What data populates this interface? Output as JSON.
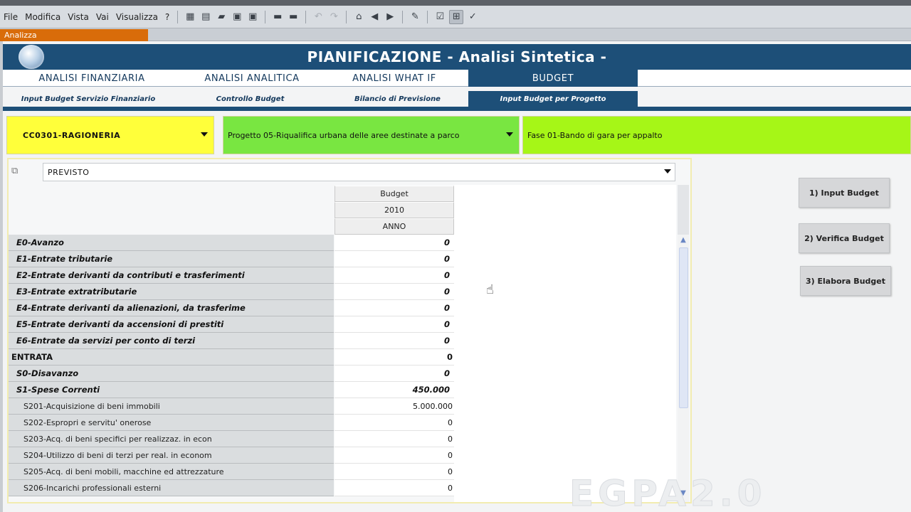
{
  "menubar": {
    "items": [
      "File",
      "Modifica",
      "Vista",
      "Vai",
      "Visualizza",
      "?"
    ]
  },
  "toolbar_icons": [
    "grid-icon",
    "page-icon",
    "folder-open-icon",
    "save-icon",
    "save-as-icon",
    "print-icon",
    "print-preview-icon",
    "undo-icon",
    "redo-icon",
    "home-icon",
    "back-icon",
    "forward-icon",
    "tools-icon",
    "checklist-icon",
    "filter-icon",
    "check-icon"
  ],
  "window_tab": {
    "label": "Analizza"
  },
  "header": {
    "title": "PIANIFICAZIONE  - Analisi Sintetica  -"
  },
  "main_tabs": [
    {
      "label": "ANALISI FINANZIARIA",
      "active": false
    },
    {
      "label": "ANALISI ANALITICA",
      "active": false
    },
    {
      "label": "ANALISI WHAT IF",
      "active": false
    },
    {
      "label": "BUDGET",
      "active": true
    }
  ],
  "sub_tabs": [
    {
      "label": "Input Budget Servizio Finanziario",
      "active": false
    },
    {
      "label": "Controllo Budget",
      "active": false
    },
    {
      "label": "Bilancio di Previsione",
      "active": false
    },
    {
      "label": "Input Budget per Progetto",
      "active": true
    }
  ],
  "selectors": {
    "cost_center": "CC0301-RAGIONERIA",
    "project": "Progetto 05-Riqualifica urbana delle aree destinate a parco",
    "phase": "Fase 01-Bando di gara per appalto"
  },
  "scenario_select": {
    "value": "PREVISTO"
  },
  "table": {
    "column_headers": [
      "Budget",
      "2010",
      "ANNO"
    ],
    "rows": [
      {
        "label": "E0-Avanzo",
        "value": "0"
      },
      {
        "label": "E1-Entrate tributarie",
        "value": "0"
      },
      {
        "label": "E2-Entrate derivanti da contributi e trasferimenti",
        "value": "0"
      },
      {
        "label": "E3-Entrate extratributarie",
        "value": "0"
      },
      {
        "label": "E4-Entrate derivanti da alienazioni, da trasferime",
        "value": "0"
      },
      {
        "label": "E5-Entrate derivanti da accensioni di prestiti",
        "value": "0"
      },
      {
        "label": "E6-Entrate da servizi per conto di terzi",
        "value": "0"
      },
      {
        "label": "ENTRATA",
        "value": "0"
      },
      {
        "label": "S0-Disavanzo",
        "value": "0"
      },
      {
        "label": "S1-Spese Correnti",
        "value": "450.000"
      },
      {
        "label": "S201-Acquisizione di beni  immobili",
        "value": "5.000.000"
      },
      {
        "label": "S202-Espropri e servitu' onerose",
        "value": "0"
      },
      {
        "label": "S203-Acq. di beni specifici per realizzaz. in econ",
        "value": "0"
      },
      {
        "label": "S204-Utilizzo di beni di terzi per real. in econom",
        "value": "0"
      },
      {
        "label": "S205-Acq. di beni mobili, macchine ed attrezzature",
        "value": "0"
      },
      {
        "label": "S206-Incarichi professionali esterni",
        "value": "0"
      }
    ]
  },
  "actions": {
    "input_budget": "1)   Input Budget",
    "verifica_budget": "2)   Verifica Budget",
    "elabora_budget": "3)   Elabora Budget"
  },
  "watermark": {
    "text": "EGPA2.0"
  }
}
